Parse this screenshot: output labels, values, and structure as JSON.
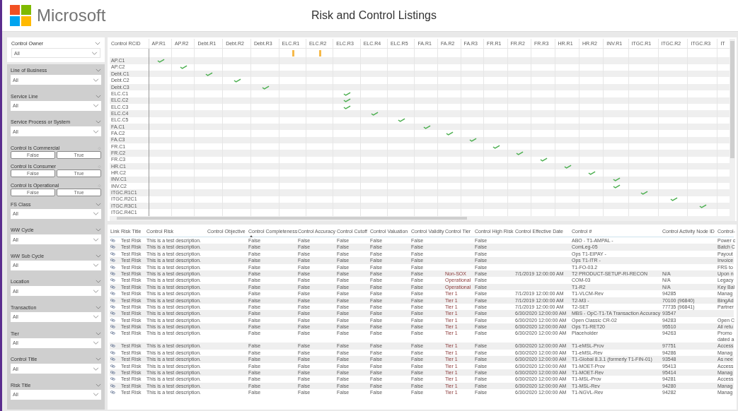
{
  "header": {
    "brand": "Microsoft",
    "title": "Risk and Control Listings"
  },
  "owner_filter": {
    "label": "Control Owner",
    "value": "All"
  },
  "filters": [
    {
      "kind": "dropdown",
      "label": "Line of Business",
      "value": "All"
    },
    {
      "kind": "dropdown",
      "label": "Service Line",
      "value": "All"
    },
    {
      "kind": "dropdown",
      "label": "Service Process or System",
      "value": "All"
    },
    {
      "kind": "toggle",
      "label": "Control Is Commercial",
      "options": [
        {
          "label": "False",
          "selected": false
        },
        {
          "label": "True",
          "selected": false
        }
      ]
    },
    {
      "kind": "toggle",
      "label": "Control Is Consumer",
      "options": [
        {
          "label": "False",
          "selected": false
        },
        {
          "label": "True",
          "selected": false
        }
      ]
    },
    {
      "kind": "toggle",
      "label": "Control Is Operational",
      "options": [
        {
          "label": "False",
          "selected": false
        },
        {
          "label": "True",
          "selected": false
        }
      ]
    },
    {
      "kind": "dropdown",
      "label": "FS Class",
      "value": "All"
    },
    {
      "kind": "dropdown",
      "label": "WW Cycle",
      "value": "All"
    },
    {
      "kind": "dropdown",
      "label": "WW Sub Cycle",
      "value": "All"
    },
    {
      "kind": "dropdown",
      "label": "Location",
      "value": "All"
    },
    {
      "kind": "dropdown",
      "label": "Transaction",
      "value": "All"
    },
    {
      "kind": "dropdown",
      "label": "Tier",
      "value": "All"
    },
    {
      "kind": "dropdown",
      "label": "Control Title",
      "value": "All"
    },
    {
      "kind": "dropdown",
      "label": "Risk Title",
      "value": "All"
    }
  ],
  "matrix": {
    "corner": "Control RCID",
    "columns": [
      "AP.R1",
      "AP.R2",
      "Debt.R1",
      "Debt.R2",
      "Debt.R3",
      "ELC.R1",
      "ELC.R2",
      "ELC.R3",
      "ELC.R4",
      "ELC.R5",
      "FA.R1",
      "FA.R2",
      "FA.R3",
      "FR.R1",
      "FR.R2",
      "FR.R3",
      "HR.R1",
      "HR.R2",
      "INV.R1",
      "ITGC.R1",
      "ITGC.R2",
      "ITGC.R3",
      "IT"
    ],
    "rows": [
      {
        "warnings": [
          false,
          false,
          false,
          false,
          false,
          true,
          true,
          false,
          false,
          false,
          false,
          false,
          false,
          false,
          false,
          false,
          false,
          false,
          false,
          false,
          false,
          false,
          false
        ]
      },
      {
        "label": "AP.C1",
        "checks": [
          true,
          false,
          false,
          false,
          false,
          false,
          false,
          false,
          false,
          false,
          false,
          false,
          false,
          false,
          false,
          false,
          false,
          false,
          false,
          false,
          false,
          false,
          false
        ]
      },
      {
        "label": "AP.C2",
        "checks": [
          false,
          true,
          false,
          false,
          false,
          false,
          false,
          false,
          false,
          false,
          false,
          false,
          false,
          false,
          false,
          false,
          false,
          false,
          false,
          false,
          false,
          false,
          false
        ]
      },
      {
        "label": "Debt.C1",
        "checks": [
          false,
          false,
          true,
          false,
          false,
          false,
          false,
          false,
          false,
          false,
          false,
          false,
          false,
          false,
          false,
          false,
          false,
          false,
          false,
          false,
          false,
          false,
          false
        ]
      },
      {
        "label": "Debt.C2",
        "checks": [
          false,
          false,
          false,
          true,
          false,
          false,
          false,
          false,
          false,
          false,
          false,
          false,
          false,
          false,
          false,
          false,
          false,
          false,
          false,
          false,
          false,
          false,
          false
        ]
      },
      {
        "label": "Debt.C3",
        "checks": [
          false,
          false,
          false,
          false,
          true,
          false,
          false,
          false,
          false,
          false,
          false,
          false,
          false,
          false,
          false,
          false,
          false,
          false,
          false,
          false,
          false,
          false,
          false
        ]
      },
      {
        "label": "ELC.C1",
        "checks": [
          false,
          false,
          false,
          false,
          false,
          false,
          false,
          true,
          false,
          false,
          false,
          false,
          false,
          false,
          false,
          false,
          false,
          false,
          false,
          false,
          false,
          false,
          false
        ]
      },
      {
        "label": "ELC.C2",
        "checks": [
          false,
          false,
          false,
          false,
          false,
          false,
          false,
          true,
          false,
          false,
          false,
          false,
          false,
          false,
          false,
          false,
          false,
          false,
          false,
          false,
          false,
          false,
          false
        ]
      },
      {
        "label": "ELC.C3",
        "checks": [
          false,
          false,
          false,
          false,
          false,
          false,
          false,
          true,
          false,
          false,
          false,
          false,
          false,
          false,
          false,
          false,
          false,
          false,
          false,
          false,
          false,
          false,
          false
        ]
      },
      {
        "label": "ELC.C4",
        "checks": [
          false,
          false,
          false,
          false,
          false,
          false,
          false,
          false,
          true,
          false,
          false,
          false,
          false,
          false,
          false,
          false,
          false,
          false,
          false,
          false,
          false,
          false,
          false
        ]
      },
      {
        "label": "ELC.C5",
        "checks": [
          false,
          false,
          false,
          false,
          false,
          false,
          false,
          false,
          false,
          true,
          false,
          false,
          false,
          false,
          false,
          false,
          false,
          false,
          false,
          false,
          false,
          false,
          false
        ]
      },
      {
        "label": "FA.C1",
        "checks": [
          false,
          false,
          false,
          false,
          false,
          false,
          false,
          false,
          false,
          false,
          true,
          false,
          false,
          false,
          false,
          false,
          false,
          false,
          false,
          false,
          false,
          false,
          false
        ]
      },
      {
        "label": "FA.C2",
        "checks": [
          false,
          false,
          false,
          false,
          false,
          false,
          false,
          false,
          false,
          false,
          false,
          true,
          false,
          false,
          false,
          false,
          false,
          false,
          false,
          false,
          false,
          false,
          false
        ]
      },
      {
        "label": "FA.C3",
        "checks": [
          false,
          false,
          false,
          false,
          false,
          false,
          false,
          false,
          false,
          false,
          false,
          false,
          true,
          false,
          false,
          false,
          false,
          false,
          false,
          false,
          false,
          false,
          false
        ]
      },
      {
        "label": "FR.C1",
        "checks": [
          false,
          false,
          false,
          false,
          false,
          false,
          false,
          false,
          false,
          false,
          false,
          false,
          false,
          true,
          false,
          false,
          false,
          false,
          false,
          false,
          false,
          false,
          false
        ]
      },
      {
        "label": "FR.C2",
        "checks": [
          false,
          false,
          false,
          false,
          false,
          false,
          false,
          false,
          false,
          false,
          false,
          false,
          false,
          false,
          true,
          false,
          false,
          false,
          false,
          false,
          false,
          false,
          false
        ]
      },
      {
        "label": "FR.C3",
        "checks": [
          false,
          false,
          false,
          false,
          false,
          false,
          false,
          false,
          false,
          false,
          false,
          false,
          false,
          false,
          false,
          true,
          false,
          false,
          false,
          false,
          false,
          false,
          false
        ]
      },
      {
        "label": "HR.C1",
        "checks": [
          false,
          false,
          false,
          false,
          false,
          false,
          false,
          false,
          false,
          false,
          false,
          false,
          false,
          false,
          false,
          false,
          true,
          false,
          false,
          false,
          false,
          false,
          false
        ]
      },
      {
        "label": "HR.C2",
        "checks": [
          false,
          false,
          false,
          false,
          false,
          false,
          false,
          false,
          false,
          false,
          false,
          false,
          false,
          false,
          false,
          false,
          false,
          true,
          false,
          false,
          false,
          false,
          false
        ]
      },
      {
        "label": "INV.C1",
        "checks": [
          false,
          false,
          false,
          false,
          false,
          false,
          false,
          false,
          false,
          false,
          false,
          false,
          false,
          false,
          false,
          false,
          false,
          false,
          true,
          false,
          false,
          false,
          false
        ]
      },
      {
        "label": "INV.C2",
        "checks": [
          false,
          false,
          false,
          false,
          false,
          false,
          false,
          false,
          false,
          false,
          false,
          false,
          false,
          false,
          false,
          false,
          false,
          false,
          true,
          false,
          false,
          false,
          false
        ]
      },
      {
        "label": "ITGC.R1C1",
        "checks": [
          false,
          false,
          false,
          false,
          false,
          false,
          false,
          false,
          false,
          false,
          false,
          false,
          false,
          false,
          false,
          false,
          false,
          false,
          false,
          true,
          false,
          false,
          false
        ]
      },
      {
        "label": "ITGC.R2C1",
        "checks": [
          false,
          false,
          false,
          false,
          false,
          false,
          false,
          false,
          false,
          false,
          false,
          false,
          false,
          false,
          false,
          false,
          false,
          false,
          false,
          false,
          true,
          false,
          false
        ]
      },
      {
        "label": "ITGC.R3C1",
        "checks": [
          false,
          false,
          false,
          false,
          false,
          false,
          false,
          false,
          false,
          false,
          false,
          false,
          false,
          false,
          false,
          false,
          false,
          false,
          false,
          false,
          false,
          true,
          false
        ]
      },
      {
        "label": "ITGC.R4C1",
        "checks": [
          false,
          false,
          false,
          false,
          false,
          false,
          false,
          false,
          false,
          false,
          false,
          false,
          false,
          false,
          false,
          false,
          false,
          false,
          false,
          false,
          false,
          false,
          false
        ]
      }
    ]
  },
  "table": {
    "columns": [
      "Link",
      "Risk Title",
      "Control Risk",
      "Control Objective",
      "Control Completeness",
      "Control Accuracy",
      "Control Cutoff",
      "Control Valuation",
      "Control Validity",
      "Control Tier",
      "Control High Risk",
      "Control Effective Date",
      "Control #",
      "Control Activity Node ID",
      "Control-"
    ],
    "rows": [
      {
        "risk_title": "Test Risk",
        "control_risk": "This is a test description.",
        "completeness": "False",
        "accuracy": "False",
        "cutoff": "False",
        "valuation": "False",
        "validity": "False",
        "high_risk": "False",
        "control_number": "ABO - T1-AMPAL -",
        "control_cut": "Power c"
      },
      {
        "risk_title": "Test Risk",
        "control_risk": "This is a test description.",
        "completeness": "False",
        "accuracy": "False",
        "cutoff": "False",
        "valuation": "False",
        "validity": "False",
        "high_risk": "False",
        "control_number": "ComLeg-05",
        "control_cut": "Batch C"
      },
      {
        "risk_title": "Test Risk",
        "control_risk": "This is a test description.",
        "completeness": "False",
        "accuracy": "False",
        "cutoff": "False",
        "valuation": "False",
        "validity": "False",
        "high_risk": "False",
        "control_number": "Ops T1-EIPAY -",
        "control_cut": "Payout"
      },
      {
        "risk_title": "Test Risk",
        "control_risk": "This is a test description.",
        "completeness": "False",
        "accuracy": "False",
        "cutoff": "False",
        "valuation": "False",
        "validity": "False",
        "high_risk": "False",
        "control_number": "Ops T1-ITR -",
        "control_cut": "Invoice"
      },
      {
        "risk_title": "Test Risk",
        "control_risk": "This is a test description.",
        "completeness": "False",
        "accuracy": "False",
        "cutoff": "False",
        "valuation": "False",
        "validity": "False",
        "high_risk": "False",
        "control_number": "T1-FO-03.2",
        "control_cut": "FRS to"
      },
      {
        "risk_title": "Test Risk",
        "control_risk": "This is a test description.",
        "completeness": "False",
        "accuracy": "False",
        "cutoff": "False",
        "valuation": "False",
        "validity": "False",
        "tier": "Non-SOX",
        "high_risk": "False",
        "effective_date": "7/1/2019 12:00:00 AM",
        "control_number": "T2 PRODUCT-SETUP-RI-RECON",
        "node_id": "N/A",
        "control_cut": "Upon n"
      },
      {
        "risk_title": "Test Risk",
        "control_risk": "This is a test description.",
        "completeness": "False",
        "accuracy": "False",
        "cutoff": "False",
        "valuation": "False",
        "validity": "False",
        "tier": "Operational",
        "high_risk": "False",
        "control_number": "COM-03",
        "node_id": "N/A",
        "control_cut": "Legacy"
      },
      {
        "risk_title": "Test Risk",
        "control_risk": "This is a test description.",
        "completeness": "False",
        "accuracy": "False",
        "cutoff": "False",
        "valuation": "False",
        "validity": "False",
        "tier": "Operational",
        "high_risk": "False",
        "control_number": "T1-R2",
        "node_id": "N/A",
        "control_cut": "Key Bal"
      },
      {
        "risk_title": "Test Risk",
        "control_risk": "This is a test description.",
        "completeness": "False",
        "accuracy": "False",
        "cutoff": "False",
        "valuation": "False",
        "validity": "False",
        "tier": "Tier 1",
        "high_risk": "False",
        "effective_date": "7/1/2019 12:00:00 AM",
        "control_number": "T1-VLCM-Rev",
        "node_id": "94285",
        "control_cut": "Manag"
      },
      {
        "risk_title": "Test Risk",
        "control_risk": "This is a test description.",
        "completeness": "False",
        "accuracy": "False",
        "cutoff": "False",
        "valuation": "False",
        "validity": "False",
        "tier": "Tier 1",
        "high_risk": "False",
        "effective_date": "7/1/2019 12:00:00 AM",
        "control_number": "T2-M3 -",
        "node_id": "70100 (96840)",
        "control_cut": "BingAd"
      },
      {
        "risk_title": "Test Risk",
        "control_risk": "This is a test description.",
        "completeness": "False",
        "accuracy": "False",
        "cutoff": "False",
        "valuation": "False",
        "validity": "False",
        "tier": "Tier 1",
        "high_risk": "False",
        "effective_date": "7/1/2019 12:00:00 AM",
        "control_number": "T2-SET",
        "node_id": "77735 (96841)",
        "control_cut": "Partner"
      },
      {
        "risk_title": "Test Risk",
        "control_risk": "This is a test description.",
        "completeness": "False",
        "accuracy": "False",
        "cutoff": "False",
        "valuation": "False",
        "validity": "False",
        "tier": "Tier 1",
        "high_risk": "False",
        "effective_date": "6/30/2020 12:00:00 AM",
        "control_number": "MBS - OpC-T1-TA Transaction Accuracy",
        "node_id": "93547"
      },
      {
        "risk_title": "Test Risk",
        "control_risk": "This is a test description.",
        "completeness": "False",
        "accuracy": "False",
        "cutoff": "False",
        "valuation": "False",
        "validity": "False",
        "tier": "Tier 1",
        "high_risk": "False",
        "effective_date": "6/30/2020 12:00:00 AM",
        "control_number": "Open Classic CR-02",
        "node_id": "94283",
        "control_cut": "Open C"
      },
      {
        "risk_title": "Test Risk",
        "control_risk": "This is a test description.",
        "completeness": "False",
        "accuracy": "False",
        "cutoff": "False",
        "valuation": "False",
        "validity": "False",
        "tier": "Tier 1",
        "high_risk": "False",
        "effective_date": "6/30/2020 12:00:00 AM",
        "control_number": "Ops T1-RET20",
        "node_id": "95510",
        "control_cut": "All retu"
      },
      {
        "risk_title": "Test Risk",
        "control_risk": "This is a test description.",
        "completeness": "False",
        "accuracy": "False",
        "cutoff": "False",
        "valuation": "False",
        "validity": "False",
        "tier": "Tier 1",
        "high_risk": "False",
        "effective_date": "6/30/2020 12:00:00 AM",
        "control_number": "Placeholder",
        "node_id": "94263",
        "control_cut": "Promo\ndated a"
      },
      {
        "risk_title": "Test Risk",
        "control_risk": "This is a test description.",
        "completeness": "False",
        "accuracy": "False",
        "cutoff": "False",
        "valuation": "False",
        "validity": "False",
        "tier": "Tier 1",
        "high_risk": "False",
        "effective_date": "6/30/2020 12:00:00 AM",
        "control_number": "T1-eMSL-Prov",
        "node_id": "97751",
        "control_cut": "Access"
      },
      {
        "risk_title": "Test Risk",
        "control_risk": "This is a test description.",
        "completeness": "False",
        "accuracy": "False",
        "cutoff": "False",
        "valuation": "False",
        "validity": "False",
        "tier": "Tier 1",
        "high_risk": "False",
        "effective_date": "6/30/2020 12:00:00 AM",
        "control_number": "T1-eMSL-Rev",
        "node_id": "94286",
        "control_cut": "Manag"
      },
      {
        "risk_title": "Test Risk",
        "control_risk": "This is a test description.",
        "completeness": "False",
        "accuracy": "False",
        "cutoff": "False",
        "valuation": "False",
        "validity": "False",
        "tier": "Tier 1",
        "high_risk": "False",
        "effective_date": "6/30/2020 12:00:00 AM",
        "control_number": "T1-Global 8.3.1 (formerly T1-FIN-01)",
        "node_id": "93548",
        "control_cut": "As nee"
      },
      {
        "risk_title": "Test Risk",
        "control_risk": "This is a test description.",
        "completeness": "False",
        "accuracy": "False",
        "cutoff": "False",
        "valuation": "False",
        "validity": "False",
        "tier": "Tier 1",
        "high_risk": "False",
        "effective_date": "6/30/2020 12:00:00 AM",
        "control_number": "T1-MOET-Prov",
        "node_id": "95413",
        "control_cut": "Access"
      },
      {
        "risk_title": "Test Risk",
        "control_risk": "This is a test description.",
        "completeness": "False",
        "accuracy": "False",
        "cutoff": "False",
        "valuation": "False",
        "validity": "False",
        "tier": "Tier 1",
        "high_risk": "False",
        "effective_date": "6/30/2020 12:00:00 AM",
        "control_number": "T1-MOET-Rev",
        "node_id": "95414",
        "control_cut": "Manag"
      },
      {
        "risk_title": "Test Risk",
        "control_risk": "This is a test description.",
        "completeness": "False",
        "accuracy": "False",
        "cutoff": "False",
        "valuation": "False",
        "validity": "False",
        "tier": "Tier 1",
        "high_risk": "False",
        "effective_date": "6/30/2020 12:00:00 AM",
        "control_number": "T1-MSL-Prov",
        "node_id": "94281",
        "control_cut": "Access"
      },
      {
        "risk_title": "Test Risk",
        "control_risk": "This is a test description.",
        "completeness": "False",
        "accuracy": "False",
        "cutoff": "False",
        "valuation": "False",
        "validity": "False",
        "tier": "Tier 1",
        "high_risk": "False",
        "effective_date": "6/30/2020 12:00:00 AM",
        "control_number": "T1-MSL-Rev",
        "node_id": "94280",
        "control_cut": "Manag"
      },
      {
        "risk_title": "Test Risk",
        "control_risk": "This is a test description.",
        "completeness": "False",
        "accuracy": "False",
        "cutoff": "False",
        "valuation": "False",
        "validity": "False",
        "tier": "Tier 1",
        "high_risk": "False",
        "effective_date": "6/30/2020 12:00:00 AM",
        "control_number": "T1-NGVL-Rev",
        "node_id": "94282",
        "control_cut": "Manag"
      }
    ]
  }
}
